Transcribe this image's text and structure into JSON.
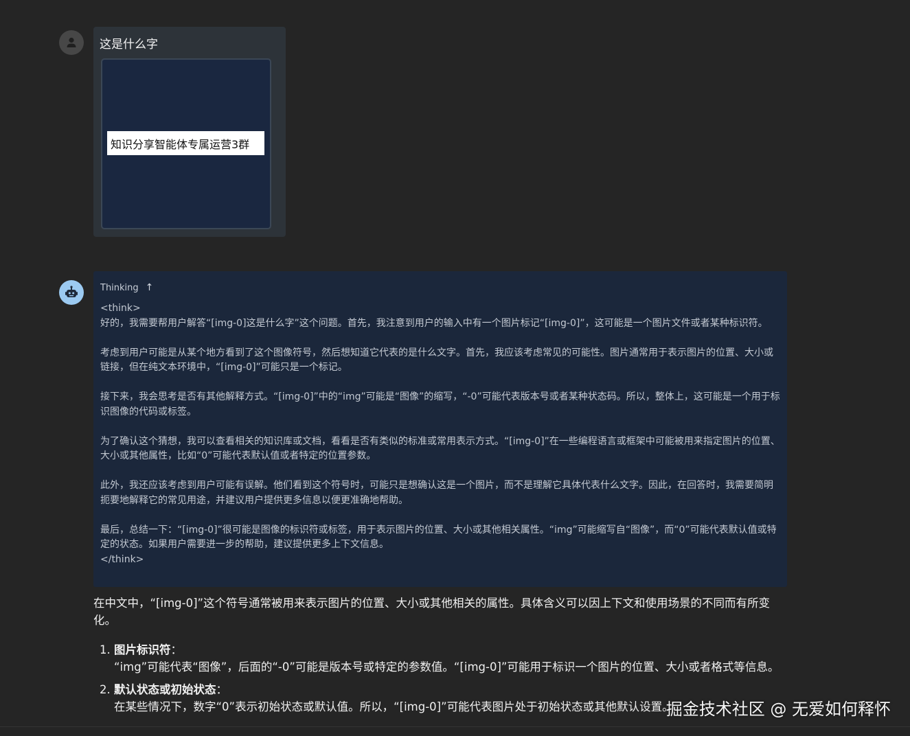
{
  "user_message": {
    "text": "这是什么字",
    "image_label": "知识分享智能体专属运营3群"
  },
  "thinking": {
    "header": "Thinking",
    "open_tag": "<think>",
    "paragraphs": [
      "好的，我需要帮用户解答“[img-0]这是什么字”这个问题。首先，我注意到用户的输入中有一个图片标记“[img-0]”，这可能是一个图片文件或者某种标识符。",
      "考虑到用户可能是从某个地方看到了这个图像符号，然后想知道它代表的是什么文字。首先，我应该考虑常见的可能性。图片通常用于表示图片的位置、大小或链接，但在纯文本环境中，“[img-0]”可能只是一个标记。",
      "接下来，我会思考是否有其他解释方式。“[img-0]”中的“img”可能是“图像”的缩写，“-0”可能代表版本号或者某种状态码。所以，整体上，这可能是一个用于标识图像的代码或标签。",
      "为了确认这个猜想，我可以查看相关的知识库或文档，看看是否有类似的标准或常用表示方式。“[img-0]”在一些编程语言或框架中可能被用来指定图片的位置、大小或其他属性，比如“0”可能代表默认值或者特定的位置参数。",
      "此外，我还应该考虑到用户可能有误解。他们看到这个符号时，可能只是想确认这是一个图片，而不是理解它具体代表什么文字。因此，在回答时，我需要简明扼要地解释它的常见用途，并建议用户提供更多信息以便更准确地帮助。",
      "最后，总结一下：“[img-0]”很可能是图像的标识符或标签，用于表示图片的位置、大小或其他相关属性。“img”可能缩写自“图像”，而“0”可能代表默认值或特定的状态。如果用户需要进一步的帮助，建议提供更多上下文信息。"
    ],
    "close_tag": "</think>"
  },
  "answer": {
    "intro": "在中文中，“[img-0]”这个符号通常被用来表示图片的位置、大小或其他相关的属性。具体含义可以因上下文和使用场景的不同而有所变化。",
    "items": [
      {
        "title": "图片标识符",
        "desc": "“img”可能代表“图像”，后面的“-0”可能是版本号或特定的参数值。“[img-0]”可能用于标识一个图片的位置、大小或者格式等信息。"
      },
      {
        "title": "默认状态或初始状态",
        "desc": "在某些情况下，数字“0”表示初始状态或默认值。所以，“[img-0]”可能代表图片处于初始状态或其他默认设置。"
      }
    ]
  },
  "watermark": "掘金技术社区 @ 无爱如何释怀",
  "icons": {
    "user_avatar": "person-icon",
    "bot_avatar": "robot-icon",
    "thinking_toggle": "arrow-up-icon"
  },
  "colors": {
    "background": "#252525",
    "thinking_bg": "#1b273b",
    "bot_avatar": "#9ccaf1"
  }
}
